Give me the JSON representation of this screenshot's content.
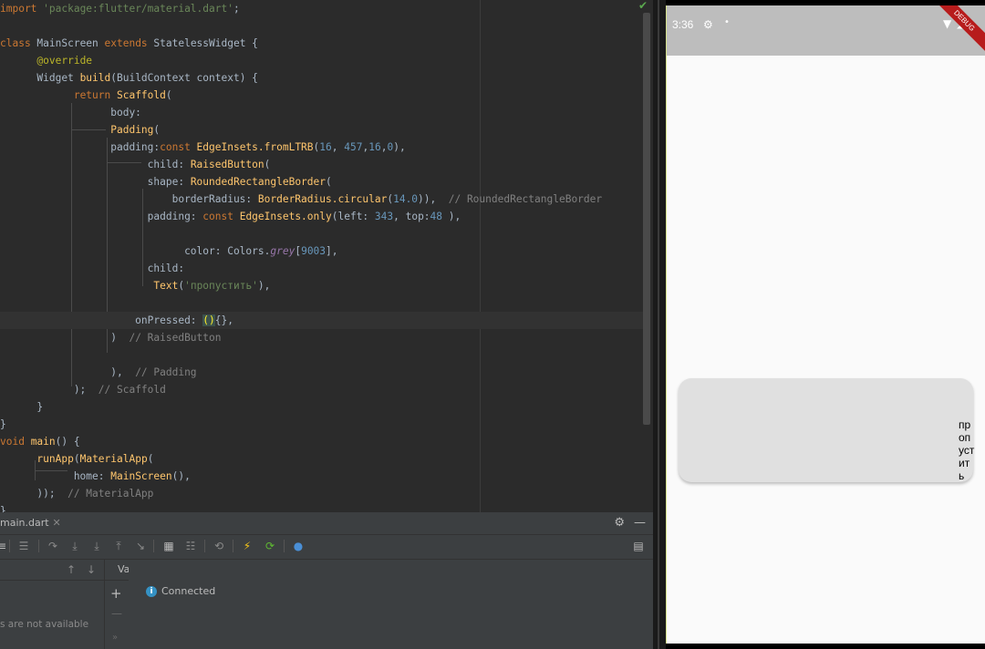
{
  "editor": {
    "lines": [
      [
        "<span class='kw'>import </span><span class='str'>'package:flutter/material.dart'</span>;"
      ],
      [
        ""
      ],
      [
        "<span class='kw'>class </span>MainScreen <span class='kw'>extends </span>StatelessWidget {"
      ],
      [
        "      <span class='ann'>@override</span>"
      ],
      [
        "      Widget <span class='cls'>build</span>(BuildContext context) {"
      ],
      [
        "            <span class='kw'>return </span><span class='cls'>Scaffold</span>("
      ],
      [
        "                  body:"
      ],
      [
        "                  <span class='cls'>Padding</span>("
      ],
      [
        "                  padding:<span class='kw'>const </span><span class='cls'>EdgeInsets.fromLTRB</span>(<span class='num'>16</span>, <span class='num'>457</span>,<span class='num'>16</span>,<span class='num'>0</span>),"
      ],
      [
        "                        child: <span class='cls'>RaisedButton</span>("
      ],
      [
        "                        shape: <span class='cls'>RoundedRectangleBorder</span>("
      ],
      [
        "                            borderRadius: <span class='cls'>BorderRadius.circular</span>(<span class='num'>14.0</span>)),  <span class='cm'>// RoundedRectangleBorder</span>"
      ],
      [
        "                        padding: <span class='kw'>const </span><span class='cls'>EdgeInsets.only</span>(left: <span class='num'>343</span>, top:<span class='num'>48</span> ),"
      ],
      [
        ""
      ],
      [
        "                              color: Colors.<span class='it'>grey</span>[<span class='num'>9003</span>],"
      ],
      [
        "                        child:"
      ],
      [
        "                         <span class='cls'>Text</span>(<span class='str'>'пропустить'</span>),"
      ],
      [
        ""
      ],
      [
        "                      onPressed: <span class='hl'>()</span>{},"
      ],
      [
        "                  )  <span class='cm'>// RaisedButton</span>"
      ],
      [
        ""
      ],
      [
        "                  ),  <span class='cm'>// Padding</span>"
      ],
      [
        "            );  <span class='cm'>// Scaffold</span>"
      ],
      [
        "      }"
      ],
      [
        "}"
      ],
      [
        "<span class='kw'>void </span><span class='cls'>main</span>() {"
      ],
      [
        "      <span class='cls'>runApp</span>(<span class='cls'>MaterialApp</span>("
      ],
      [
        "            home: <span class='cls'>MainScreen</span>(),"
      ],
      [
        "      ));  <span class='cm'>// MaterialApp</span>"
      ],
      [
        "}"
      ]
    ],
    "current_line_index": 18
  },
  "tool_window": {
    "tab_label": "main.dart",
    "variables_label": "Variables",
    "connected_label": "Connected",
    "not_available_label": "s are not available"
  },
  "phone": {
    "time": "3:36",
    "debug_banner": "DEBUG",
    "button_text": "пропустить",
    "button_color": "#e0e0e0",
    "status_bar_color": "#bdbdbd"
  }
}
